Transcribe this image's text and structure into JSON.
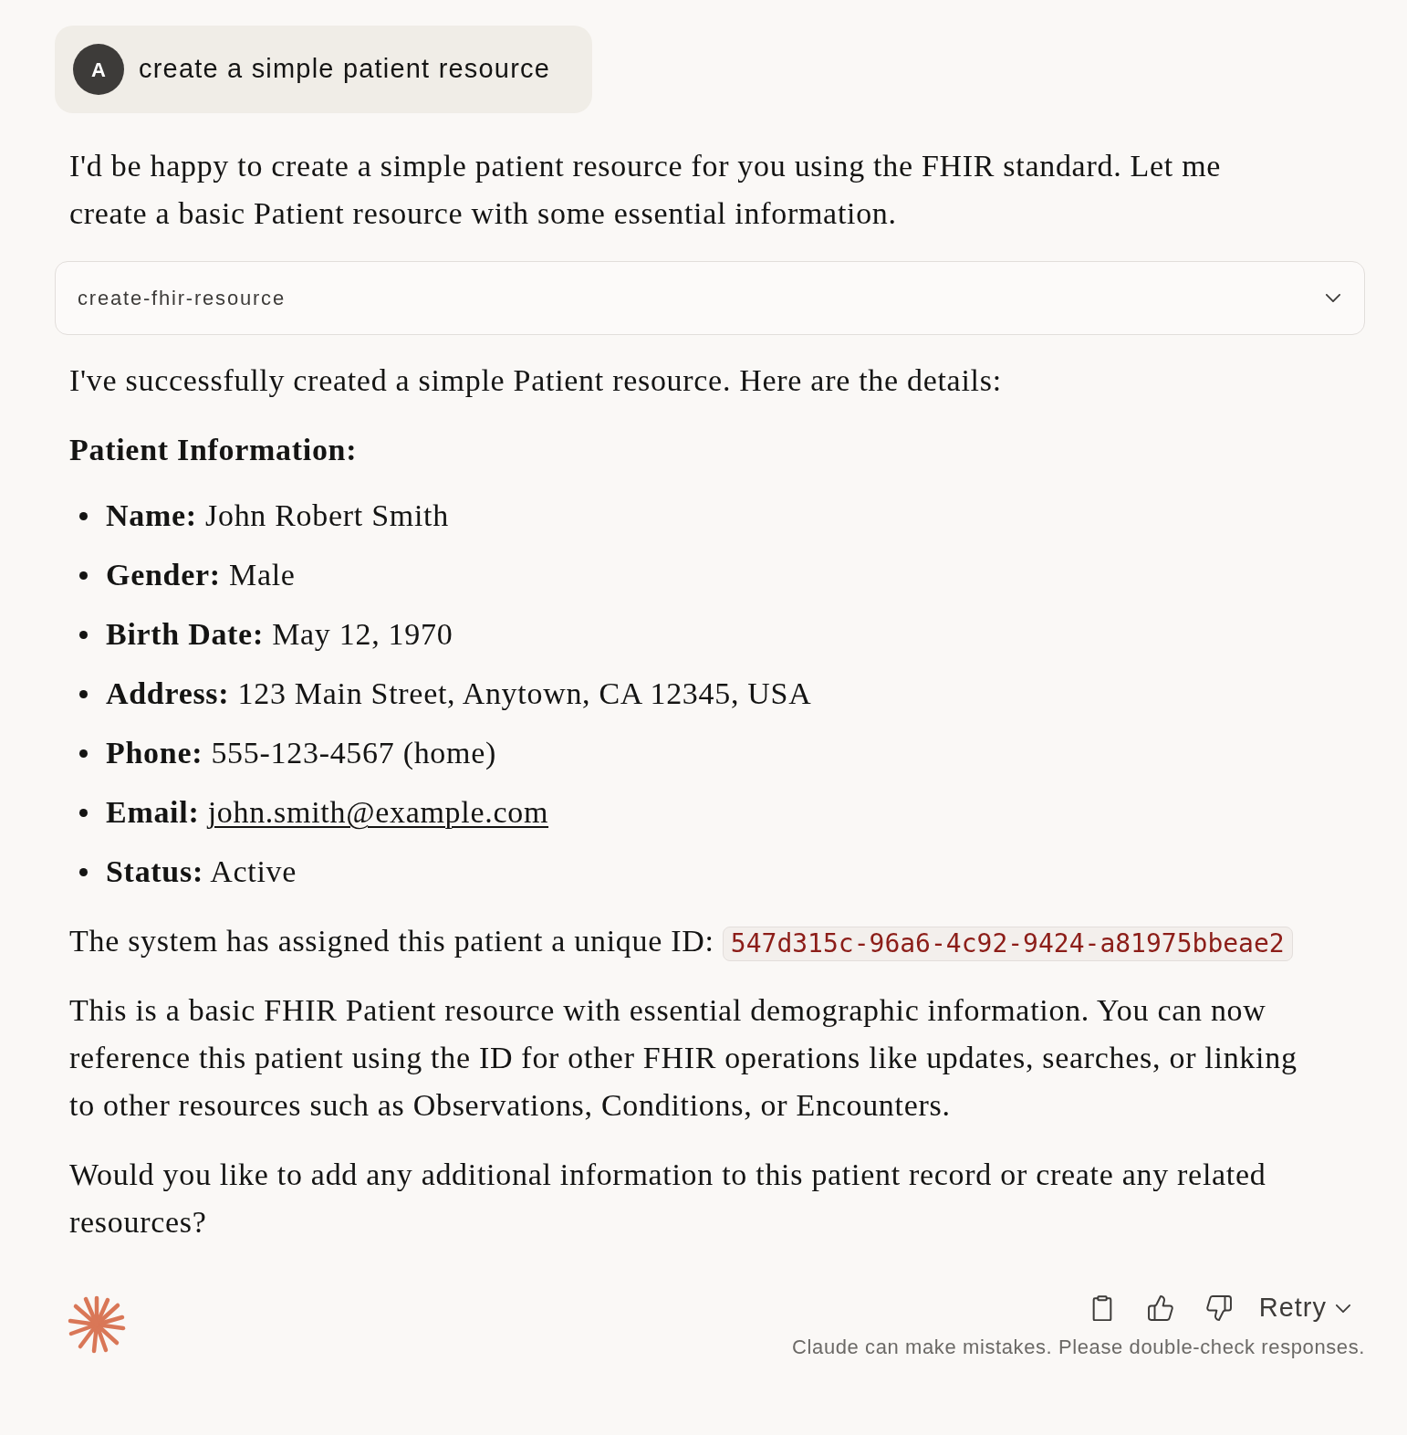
{
  "user_message": {
    "avatar": "A",
    "text": "create a simple patient resource"
  },
  "response": {
    "blocks": [
      {
        "kind": "paragraph",
        "text": "I'd be happy to create a simple patient resource for you using the FHIR standard. Let me create a basic Patient resource with some essential information."
      },
      {
        "kind": "tool_call",
        "name": "create-fhir-resource",
        "expanded": false
      },
      {
        "kind": "paragraph",
        "text": "I've successfully created a simple Patient resource. Here are the details:"
      },
      {
        "kind": "heading",
        "text": "Patient Information:"
      },
      {
        "kind": "list",
        "items": [
          {
            "text": "**Name:** John Robert Smith"
          },
          {
            "text": "**Gender:** Male"
          },
          {
            "text": "**Birth Date:** May 12, 1970"
          },
          {
            "text": "**Address:** 123 Main Street, Anytown, CA 12345, USA"
          },
          {
            "text": "**Phone:** 555-123-4567 (home)"
          },
          {
            "text": "**Email:**",
            "link": "john.smith@example.com"
          },
          {
            "text": "**Status:** Active"
          }
        ]
      },
      {
        "kind": "paragraph",
        "text": "The system has assigned this patient a unique ID:",
        "code": "547d315c-96a6-4c92-9424-a81975bbeae2"
      },
      {
        "kind": "paragraph",
        "text": "This is a basic FHIR Patient resource with essential demographic information. You can now reference this patient using the ID for other FHIR operations like updates, searches, or linking to other resources such as Observations, Conditions, or Encounters."
      },
      {
        "kind": "paragraph",
        "text": "Would you like to add any additional information to this patient record or create any related resources?"
      }
    ]
  },
  "footer": {
    "retry_label": "Retry",
    "disclaimer": "Claude can make mistakes. Please double-check responses."
  }
}
